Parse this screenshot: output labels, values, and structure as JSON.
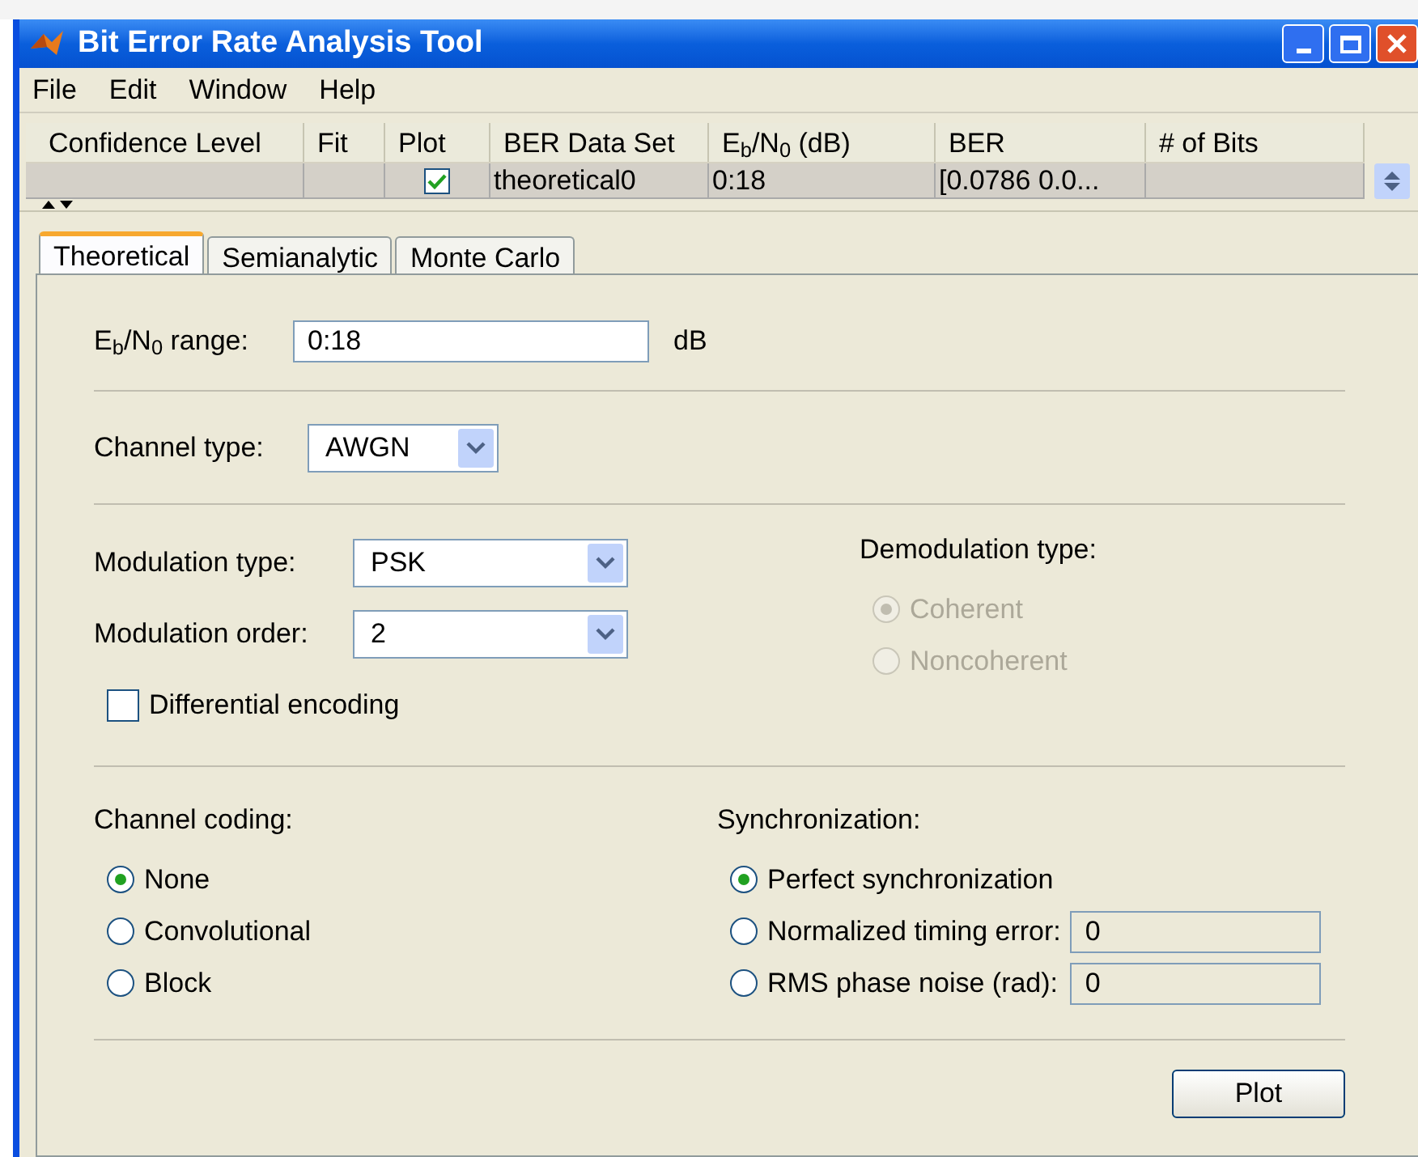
{
  "window": {
    "title": "Bit Error Rate Analysis Tool"
  },
  "menu": [
    "File",
    "Edit",
    "Window",
    "Help"
  ],
  "table": {
    "columns": [
      "Confidence Level",
      "Fit",
      "Plot",
      "BER Data Set",
      "E$_{b}$/N$_{0}$ (dB)",
      "BER",
      "# of Bits"
    ],
    "rows": [
      {
        "plot": true,
        "ber_data_set": "theoretical0",
        "eb_n0": "0:18",
        "ber": "[0.0786  0.0..."
      }
    ]
  },
  "tabs": [
    {
      "label": "Theoretical",
      "selected": true
    },
    {
      "label": "Semianalytic",
      "selected": false
    },
    {
      "label": "Monte Carlo",
      "selected": false
    }
  ],
  "ebn0_range": {
    "label": "E$_{b}$/N$_{0}$ range:",
    "value": "0:18",
    "unit": "dB"
  },
  "channel_type": {
    "label": "Channel type:",
    "value": "AWGN"
  },
  "modulation_type": {
    "label": "Modulation type:",
    "value": "PSK"
  },
  "modulation_order": {
    "label": "Modulation order:",
    "value": "2"
  },
  "differential_encoding": {
    "label": "Differential encoding",
    "checked": false
  },
  "demodulation_type": {
    "title": "Demodulation type:",
    "options": [
      {
        "label": "Coherent",
        "selected": true,
        "disabled": true
      },
      {
        "label": "Noncoherent",
        "selected": false,
        "disabled": true
      }
    ]
  },
  "channel_coding": {
    "title": "Channel coding:",
    "options": [
      {
        "label": "None",
        "selected": true
      },
      {
        "label": "Convolutional",
        "selected": false
      },
      {
        "label": "Block",
        "selected": false
      }
    ]
  },
  "synchronization": {
    "title": "Synchronization:",
    "options": [
      {
        "label": "Perfect synchronization",
        "selected": true
      },
      {
        "label": "Normalized timing error:",
        "selected": false,
        "value": "0"
      },
      {
        "label": "RMS phase noise (rad):",
        "selected": false,
        "value": "0"
      }
    ]
  },
  "plot_button": "Plot"
}
